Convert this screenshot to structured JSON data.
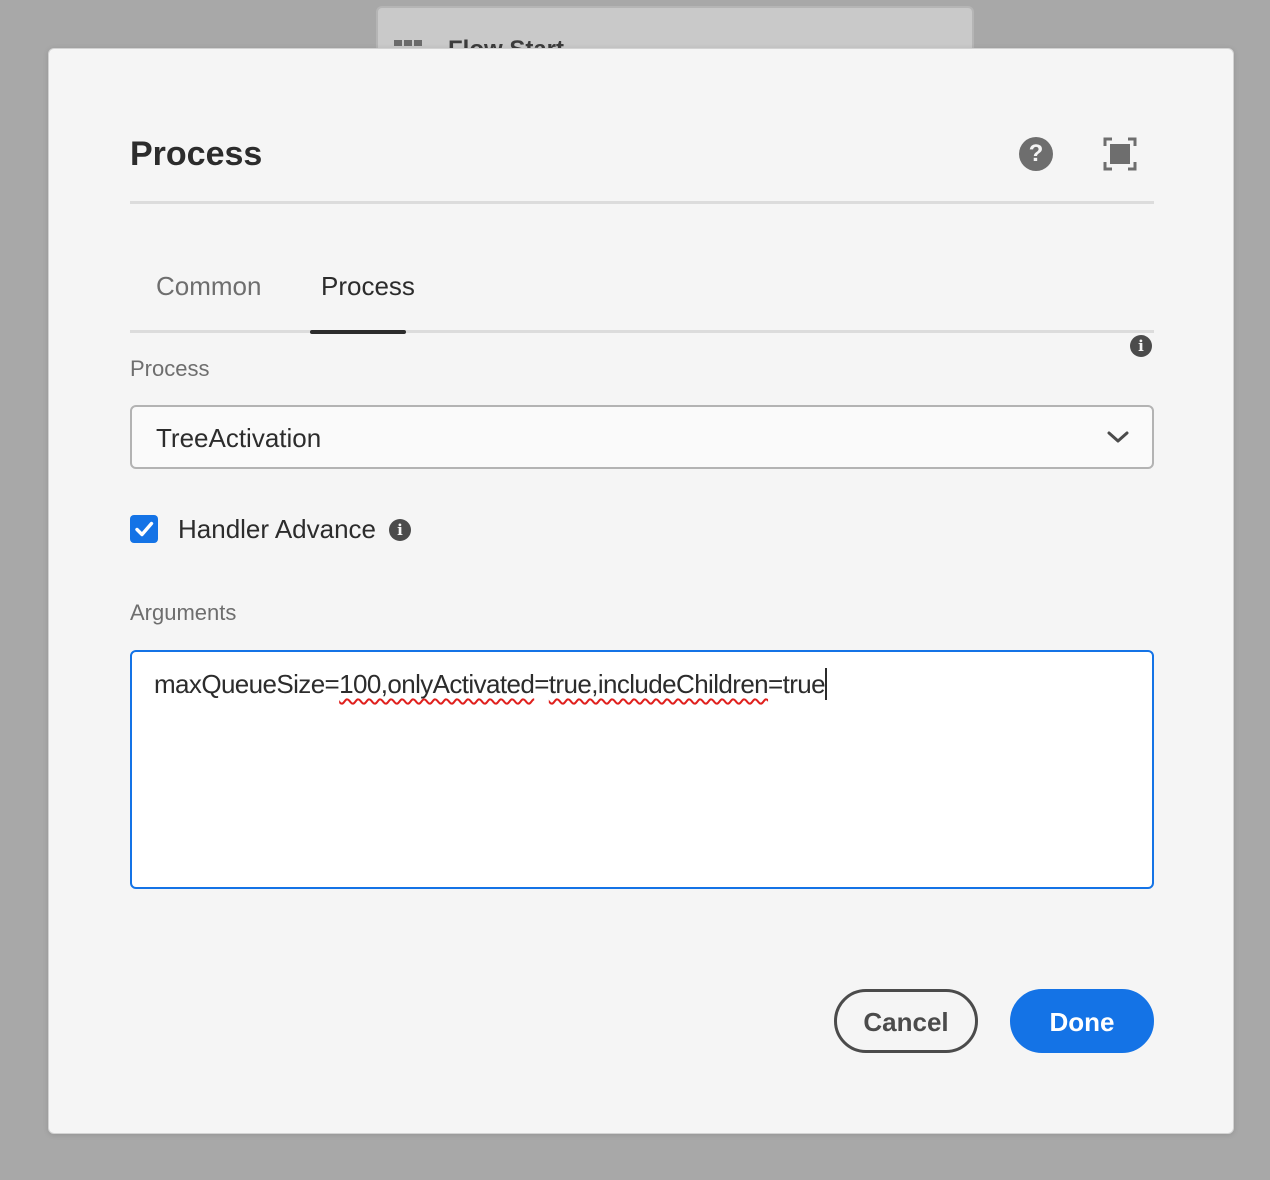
{
  "background": {
    "card_title": "Flow Start",
    "card_icon": "table-grid-icon"
  },
  "dialog": {
    "title": "Process",
    "help_icon": "?",
    "fullscreen_icon": "fullscreen-icon"
  },
  "tabs": [
    {
      "label": "Common",
      "selected": false
    },
    {
      "label": "Process",
      "selected": true
    }
  ],
  "process_field": {
    "label": "Process",
    "info_icon": "i",
    "selected_value": "TreeActivation"
  },
  "handler_advance": {
    "label": "Handler Advance",
    "checked": true,
    "info_icon": "i"
  },
  "arguments_field": {
    "label": "Arguments",
    "value_parts": [
      {
        "text": "maxQueueSize=",
        "spell_error": false
      },
      {
        "text": "100,onlyActivated",
        "spell_error": true
      },
      {
        "text": "=",
        "spell_error": false
      },
      {
        "text": "true,includeChildren",
        "spell_error": true
      },
      {
        "text": "=true",
        "spell_error": false
      }
    ]
  },
  "buttons": {
    "cancel": "Cancel",
    "done": "Done"
  },
  "colors": {
    "accent": "#1473e6",
    "dialog_bg": "#f5f5f5",
    "overlay_bg": "#a8a8a8",
    "spell_error": "#e0201d"
  }
}
